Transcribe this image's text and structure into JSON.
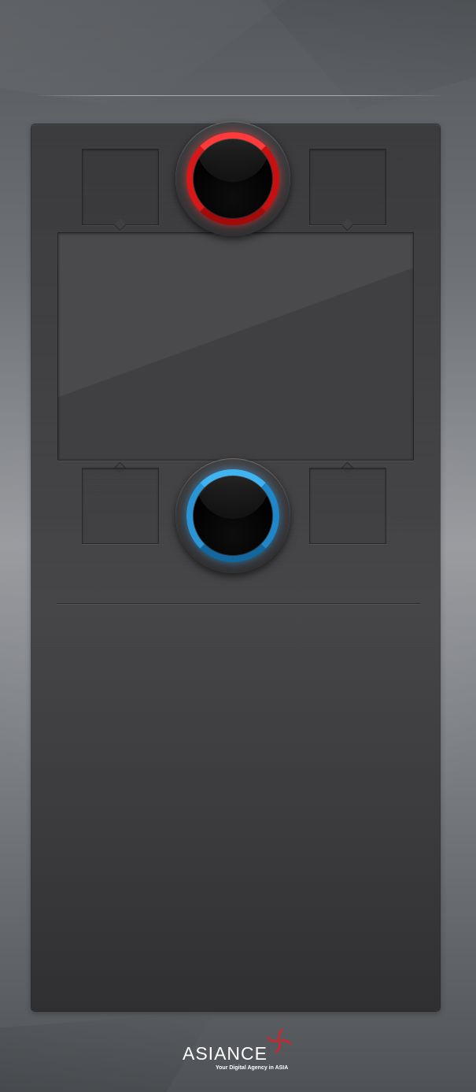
{
  "logo": {
    "name": "ASIANCE",
    "tagline": "Your Digital Agency in ASIA",
    "mark_color": "#d4242a"
  },
  "players": {
    "top": {
      "color": "red",
      "ring_color": "#e21b1b"
    },
    "bottom": {
      "color": "blue",
      "ring_color": "#2596d8"
    }
  },
  "board": {
    "slots_top": [
      "",
      ""
    ],
    "slots_bottom": [
      "",
      ""
    ],
    "main_screen_text": ""
  }
}
